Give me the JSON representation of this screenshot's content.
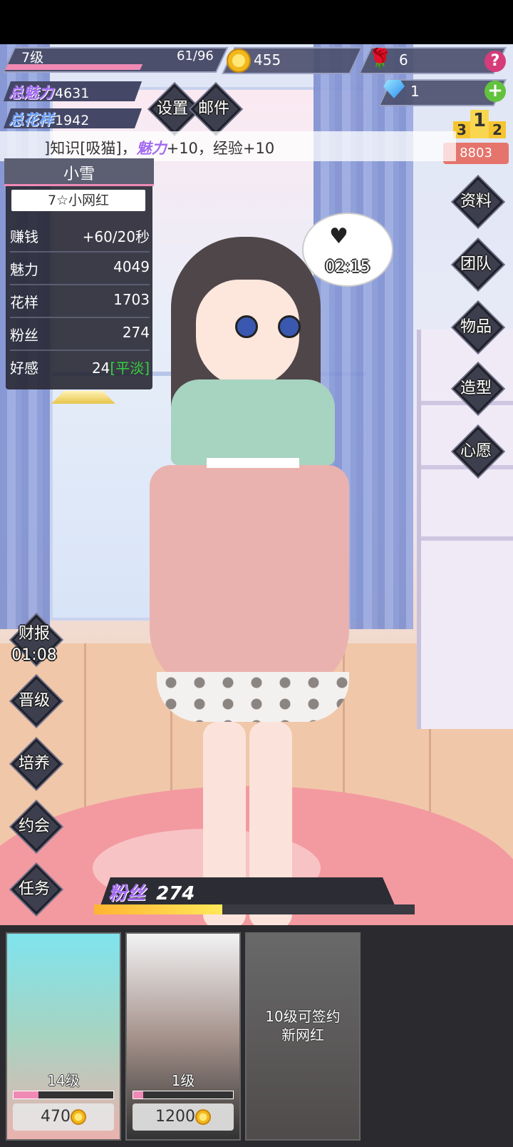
{
  "player": {
    "level": "7级",
    "exp": "61/96",
    "exp_fraction": 0.64
  },
  "currency": {
    "gold": "455",
    "roses": "6",
    "diamonds": "1"
  },
  "totals": {
    "charm_label": "总魅力",
    "charm_value": "4631",
    "pattern_label": "总花样",
    "pattern_value": "1942"
  },
  "menu": {
    "settings": "设置",
    "mail": "邮件"
  },
  "ranking": {
    "value": "8803",
    "podium": [
      "3",
      "1",
      "2"
    ]
  },
  "ticker": {
    "prefix": "]知识[吸猫]，",
    "highlight": "魅力",
    "suffix": "+10，经验+10"
  },
  "character": {
    "name": "小雪",
    "title": "7☆小网红",
    "stats": [
      {
        "key": "赚钱",
        "value": "+60/20秒"
      },
      {
        "key": "魅力",
        "value": "4049"
      },
      {
        "key": "花样",
        "value": "1703"
      },
      {
        "key": "粉丝",
        "value": "274"
      },
      {
        "key": "好感",
        "value": "24",
        "extra": "[平淡]"
      }
    ],
    "timer": "02:15"
  },
  "right_menu": [
    "资料",
    "团队",
    "物品",
    "造型",
    "心愿"
  ],
  "left_menu": {
    "report_label": "财报",
    "report_timer": "01:08",
    "items": [
      "晋级",
      "培养",
      "约会",
      "任务"
    ]
  },
  "fans": {
    "label": "粉丝",
    "value": "274",
    "fraction": 0.4
  },
  "cards": [
    {
      "level": "14级",
      "price": "470",
      "progress": 0.25
    },
    {
      "level": "1级",
      "price": "1200",
      "progress": 0.1
    },
    {
      "locked_text_1": "10级可签约",
      "locked_text_2": "新网红"
    }
  ],
  "colors": {
    "accent_pink": "#f08ab5",
    "calm_green": "#35d13d",
    "panel_bg": "#2a2a34"
  }
}
